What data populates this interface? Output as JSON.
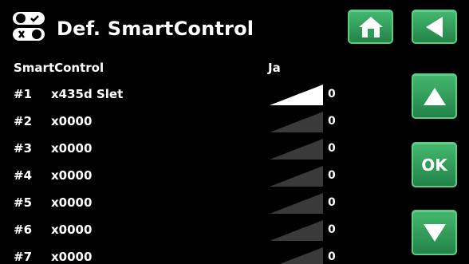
{
  "header": {
    "title": "Def. SmartControl",
    "icon": "toggle-switches-icon"
  },
  "nav": {
    "home_icon": "home-icon",
    "back_icon": "back-arrow-icon",
    "up_icon": "arrow-up-icon",
    "ok_label": "OK",
    "down_icon": "arrow-down-icon"
  },
  "colors": {
    "button_green": "#2f9c5a",
    "ramp_active": "#ffffff",
    "ramp_inactive": "#3a3a3a"
  },
  "setting": {
    "label": "SmartControl",
    "value": "Ja"
  },
  "rows": [
    {
      "num": "#1",
      "label": "x435d Slet",
      "value": "0",
      "active": true
    },
    {
      "num": "#2",
      "label": "x0000",
      "value": "0",
      "active": false
    },
    {
      "num": "#3",
      "label": "x0000",
      "value": "0",
      "active": false
    },
    {
      "num": "#4",
      "label": "x0000",
      "value": "0",
      "active": false
    },
    {
      "num": "#5",
      "label": "x0000",
      "value": "0",
      "active": false
    },
    {
      "num": "#6",
      "label": "x0000",
      "value": "0",
      "active": false
    },
    {
      "num": "#7",
      "label": "x0000",
      "value": "0",
      "active": false
    }
  ]
}
